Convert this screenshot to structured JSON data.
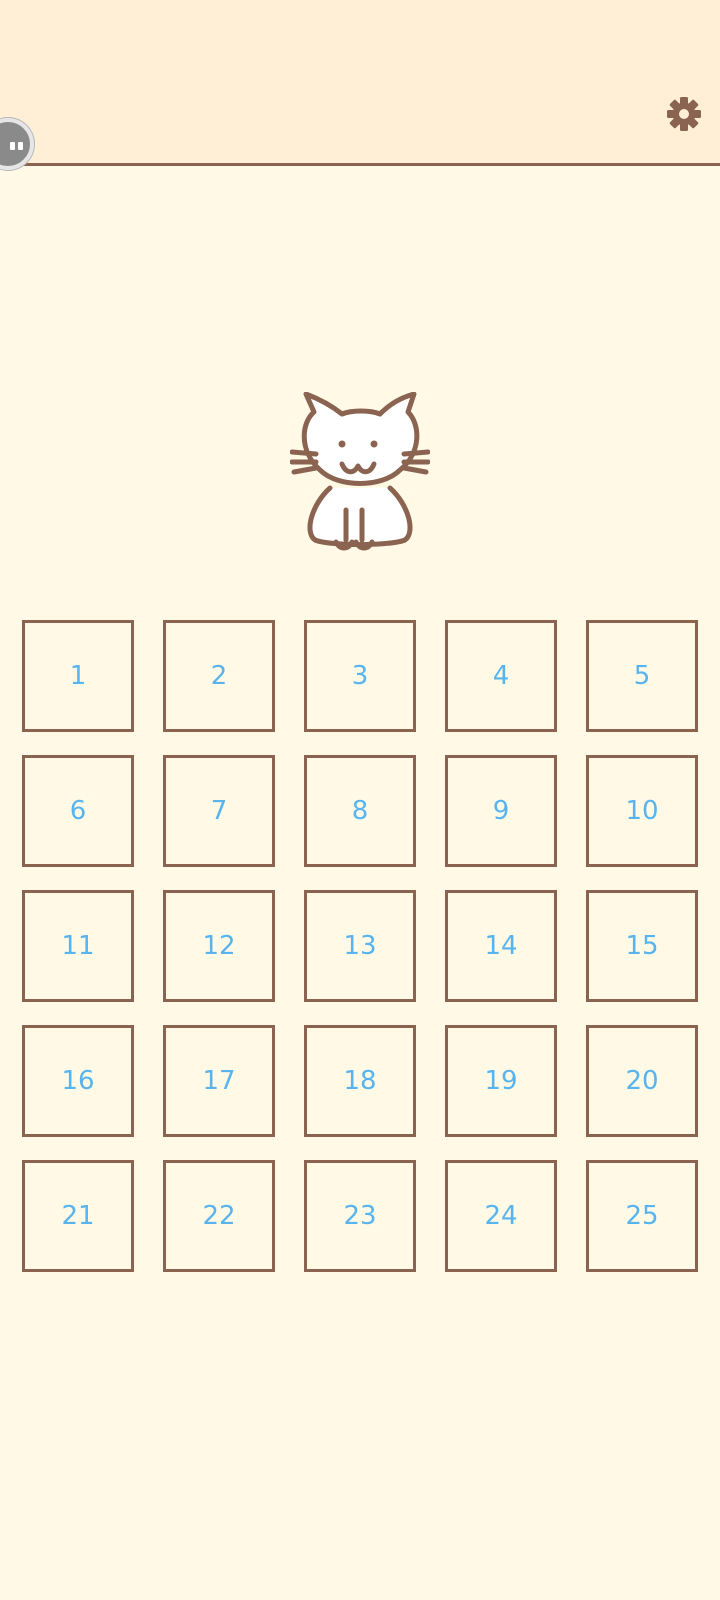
{
  "header": {
    "settings_icon": "gear-icon",
    "floating_button_icon": "pause-bubble-icon"
  },
  "mascot": {
    "icon": "cat-icon"
  },
  "colors": {
    "background": "#fff9e6",
    "header_background": "#ffefd6",
    "border_brown": "#8a6450",
    "level_number_blue": "#58b4ee"
  },
  "levels": [
    "1",
    "2",
    "3",
    "4",
    "5",
    "6",
    "7",
    "8",
    "9",
    "10",
    "11",
    "12",
    "13",
    "14",
    "15",
    "16",
    "17",
    "18",
    "19",
    "20",
    "21",
    "22",
    "23",
    "24",
    "25"
  ]
}
